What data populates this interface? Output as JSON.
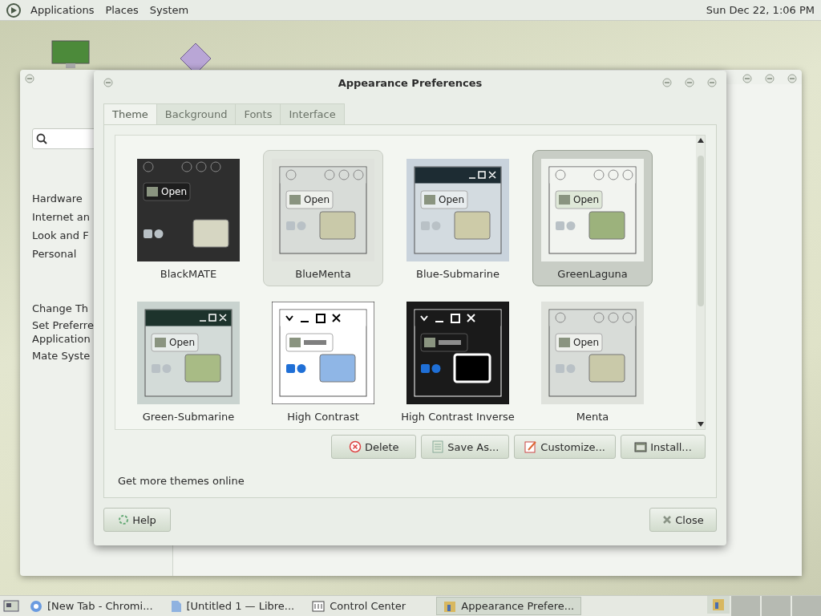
{
  "top_panel": {
    "menus": [
      "Applications",
      "Places",
      "System"
    ],
    "clock": "Sun Dec 22, 1:06 PM"
  },
  "background_window": {
    "groups": [
      "Hardware",
      "Internet an",
      "Look and F",
      "Personal"
    ],
    "tasks": [
      "Change Th",
      "Set Preferre\nApplication",
      "Mate Syste"
    ]
  },
  "dialog": {
    "title": "Appearance Preferences",
    "tabs": [
      {
        "label": "Theme",
        "selected": true
      },
      {
        "label": "Background",
        "selected": false
      },
      {
        "label": "Fonts",
        "selected": false
      },
      {
        "label": "Interface",
        "selected": false
      }
    ],
    "themes": [
      {
        "name": "BlackMATE",
        "kind": "dark",
        "selected": false,
        "hovered": false,
        "preview_button": "Open"
      },
      {
        "name": "BlueMenta",
        "kind": "menta",
        "selected": false,
        "hovered": true,
        "preview_button": "Open"
      },
      {
        "name": "Blue-Submarine",
        "kind": "bluesub",
        "selected": false,
        "hovered": false,
        "preview_button": "Open"
      },
      {
        "name": "GreenLaguna",
        "kind": "laguna",
        "selected": true,
        "hovered": false,
        "preview_button": "Open"
      },
      {
        "name": "Green-Submarine",
        "kind": "greensub",
        "selected": false,
        "hovered": false,
        "preview_button": "Open"
      },
      {
        "name": "High Contrast",
        "kind": "hc",
        "selected": false,
        "hovered": false
      },
      {
        "name": "High Contrast Inverse",
        "kind": "hci",
        "selected": false,
        "hovered": false
      },
      {
        "name": "Menta",
        "kind": "menta",
        "selected": false,
        "hovered": false,
        "preview_button": "Open"
      }
    ],
    "actions": [
      {
        "label": "Delete",
        "kind": "delete"
      },
      {
        "label": "Save As...",
        "kind": "save"
      },
      {
        "label": "Customize...",
        "kind": "customize"
      },
      {
        "label": "Install...",
        "kind": "install"
      }
    ],
    "link": "Get more themes online",
    "help": "Help",
    "close": "Close"
  },
  "taskbar": {
    "items": [
      {
        "label": "[New Tab - Chromi...",
        "kind": "browser",
        "selected": false
      },
      {
        "label": "[Untitled 1 — Libre...",
        "kind": "document",
        "selected": false
      },
      {
        "label": "Control Center",
        "kind": "control",
        "selected": false
      },
      {
        "label": "Appearance Prefere...",
        "kind": "appearance",
        "selected": true
      }
    ]
  }
}
